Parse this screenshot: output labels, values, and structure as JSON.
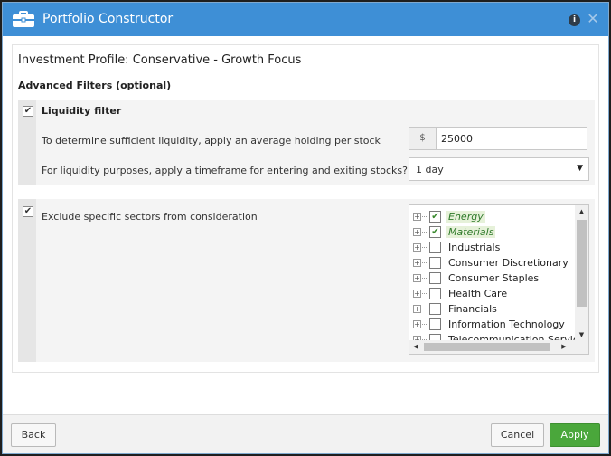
{
  "window": {
    "title": "Portfolio Constructor",
    "help_icon": "info-icon",
    "close_glyph": "✕"
  },
  "profile": {
    "title": "Investment Profile: Conservative - Growth Focus"
  },
  "advanced": {
    "heading": "Advanced Filters (optional)"
  },
  "liquidity": {
    "checked": true,
    "label": "Liquidity filter",
    "holding_text": "To determine sufficient liquidity, apply an average holding per stock",
    "currency_symbol": "$",
    "holding_value": "25000",
    "timeframe_text": "For liquidity purposes, apply a timeframe for entering and exiting stocks?",
    "timeframe_value": "1 day"
  },
  "sectors": {
    "checked": true,
    "label": "Exclude specific sectors from consideration",
    "items": [
      {
        "label": "Energy",
        "checked": true
      },
      {
        "label": "Materials",
        "checked": true
      },
      {
        "label": "Industrials",
        "checked": false
      },
      {
        "label": "Consumer Discretionary",
        "checked": false
      },
      {
        "label": "Consumer Staples",
        "checked": false
      },
      {
        "label": "Health Care",
        "checked": false
      },
      {
        "label": "Financials",
        "checked": false
      },
      {
        "label": "Information Technology",
        "checked": false
      },
      {
        "label": "Telecommunication Services",
        "checked": false
      }
    ]
  },
  "footer": {
    "back_label": "Back",
    "cancel_label": "Cancel",
    "apply_label": "Apply"
  },
  "colors": {
    "titlebar": "#3e8fd6",
    "accent_green": "#4aa73b",
    "selected_text": "#2f7a2a"
  }
}
